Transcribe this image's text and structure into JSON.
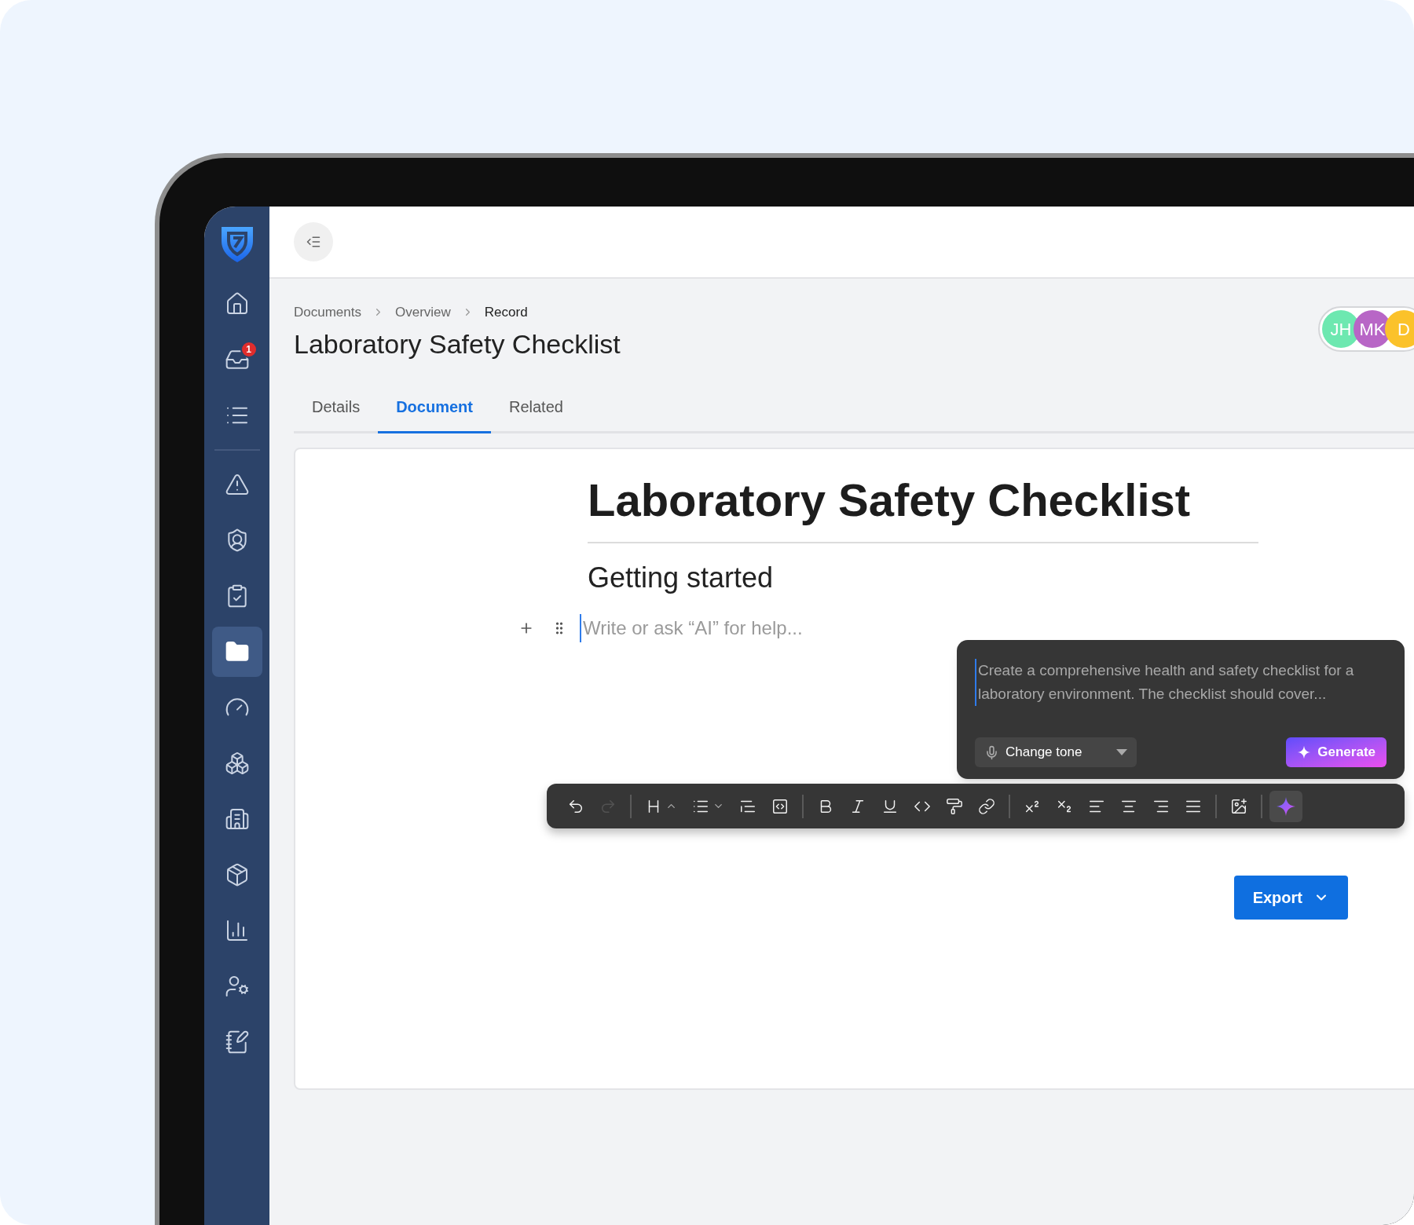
{
  "sidebar": {
    "items": [
      {
        "selected": false
      },
      {
        "selected": false,
        "badge": "1"
      },
      {
        "selected": false
      },
      {
        "selected": false
      },
      {
        "selected": false
      },
      {
        "selected": false
      },
      {
        "selected": true
      },
      {
        "selected": false
      },
      {
        "selected": false
      },
      {
        "selected": false
      },
      {
        "selected": false
      },
      {
        "selected": false
      },
      {
        "selected": false
      },
      {
        "selected": false
      }
    ]
  },
  "breadcrumbs": [
    {
      "label": "Documents",
      "current": false
    },
    {
      "label": "Overview",
      "current": false
    },
    {
      "label": "Record",
      "current": true
    }
  ],
  "page_title": "Laboratory Safety Checklist",
  "avatars": [
    {
      "initials": "JH",
      "color": "#6de8b0"
    },
    {
      "initials": "MK",
      "color": "#b866c6"
    },
    {
      "initials": "D",
      "color": "#fbc22a"
    }
  ],
  "tabs": [
    {
      "label": "Details",
      "selected": false
    },
    {
      "label": "Document",
      "selected": true
    },
    {
      "label": "Related",
      "selected": false
    }
  ],
  "document": {
    "title": "Laboratory Safety Checklist",
    "heading": "Getting started",
    "placeholder": "Write or ask “AI” for help..."
  },
  "ai_prompt": {
    "text": "Create a comprehensive health and safety checklist for a laboratory environment. The checklist should cover...",
    "tone": "Change tone",
    "generate": "Generate"
  },
  "toolbar": [
    {
      "kind": "undo",
      "disabled": false,
      "selected": false
    },
    {
      "kind": "redo",
      "disabled": true,
      "selected": false
    },
    {
      "kind": "sep"
    },
    {
      "kind": "heading",
      "disabled": false,
      "selected": false
    },
    {
      "kind": "list",
      "disabled": false,
      "selected": false
    },
    {
      "kind": "quote",
      "disabled": false,
      "selected": false
    },
    {
      "kind": "codeblock",
      "disabled": false,
      "selected": false
    },
    {
      "kind": "sep"
    },
    {
      "kind": "bold",
      "disabled": false,
      "selected": false
    },
    {
      "kind": "italic",
      "disabled": false,
      "selected": false
    },
    {
      "kind": "underline",
      "disabled": false,
      "selected": false
    },
    {
      "kind": "code",
      "disabled": false,
      "selected": false
    },
    {
      "kind": "format",
      "disabled": false,
      "selected": false
    },
    {
      "kind": "link",
      "disabled": false,
      "selected": false
    },
    {
      "kind": "sep"
    },
    {
      "kind": "superscript",
      "disabled": false,
      "selected": false
    },
    {
      "kind": "subscript",
      "disabled": false,
      "selected": false
    },
    {
      "kind": "align-left",
      "disabled": false,
      "selected": false
    },
    {
      "kind": "align-center",
      "disabled": false,
      "selected": false
    },
    {
      "kind": "align-right",
      "disabled": false,
      "selected": false
    },
    {
      "kind": "justify",
      "disabled": false,
      "selected": false
    },
    {
      "kind": "sep"
    },
    {
      "kind": "image",
      "disabled": false,
      "selected": false
    },
    {
      "kind": "sep"
    },
    {
      "kind": "ai",
      "disabled": false,
      "selected": true
    }
  ],
  "export_button": "Export"
}
